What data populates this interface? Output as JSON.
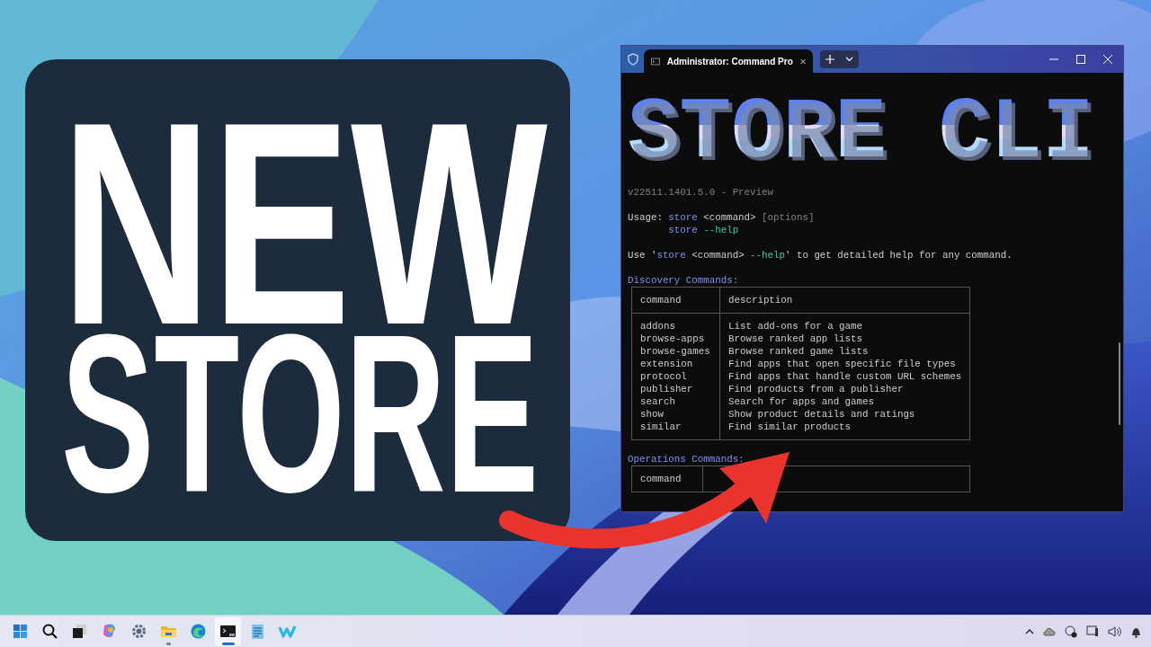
{
  "headline": {
    "lines": [
      "NEW",
      "STORE"
    ]
  },
  "terminal": {
    "tab": {
      "title": "Administrator: Command Pro",
      "selected": true
    },
    "banner": "STORE CLI",
    "lines": [
      {
        "kind": "note",
        "parts": [
          {
            "text": "v22511.1401.5.0 - Preview",
            "kind": "dim"
          }
        ]
      },
      {
        "kind": "blank"
      },
      {
        "kind": "text",
        "parts": [
          {
            "text": "Usage: ",
            "kind": "plain"
          },
          {
            "text": "store",
            "kind": "keyword"
          },
          {
            "text": " <command> ",
            "kind": "plain"
          },
          {
            "text": "[options]",
            "kind": "dim"
          }
        ]
      },
      {
        "kind": "indented",
        "parts": [
          {
            "text": "store ",
            "kind": "keyword"
          },
          {
            "text": "--help",
            "kind": "flag"
          }
        ]
      },
      {
        "kind": "blank"
      },
      {
        "kind": "text",
        "parts": [
          {
            "text": "Use '",
            "kind": "plain"
          },
          {
            "text": "store",
            "kind": "keyword"
          },
          {
            "text": " <command> ",
            "kind": "plain"
          },
          {
            "text": "--help",
            "kind": "flag"
          },
          {
            "text": "' to get detailed help for any command.",
            "kind": "plain"
          }
        ]
      },
      {
        "kind": "blank"
      }
    ],
    "sections": [
      {
        "heading": "Discovery Commands:",
        "columns": [
          "command",
          "description"
        ],
        "rows": [
          [
            "addons",
            "List add-ons for a game"
          ],
          [
            "browse-apps",
            "Browse ranked app lists"
          ],
          [
            "browse-games",
            "Browse ranked game lists"
          ],
          [
            "extension",
            "Find apps that open specific file types"
          ],
          [
            "protocol",
            "Find apps that handle custom URL schemes"
          ],
          [
            "publisher",
            "Find products from a publisher"
          ],
          [
            "search",
            "Search for apps and games"
          ],
          [
            "show",
            "Show product details and ratings"
          ],
          [
            "similar",
            "Find similar products"
          ]
        ]
      },
      {
        "heading": "Operations Commands:",
        "columns": [
          "command"
        ]
      }
    ]
  },
  "taskbar": {
    "apps": [
      {
        "selected": false,
        "running": false
      },
      {
        "selected": false,
        "running": false
      },
      {
        "selected": false,
        "running": false
      },
      {
        "selected": false,
        "running": false
      },
      {
        "selected": false,
        "running": false
      },
      {
        "selected": false,
        "running": true
      },
      {
        "selected": false,
        "running": false
      },
      {
        "selected": true,
        "running": true
      },
      {
        "selected": false,
        "running": false
      },
      {
        "selected": false,
        "running": false
      }
    ]
  }
}
